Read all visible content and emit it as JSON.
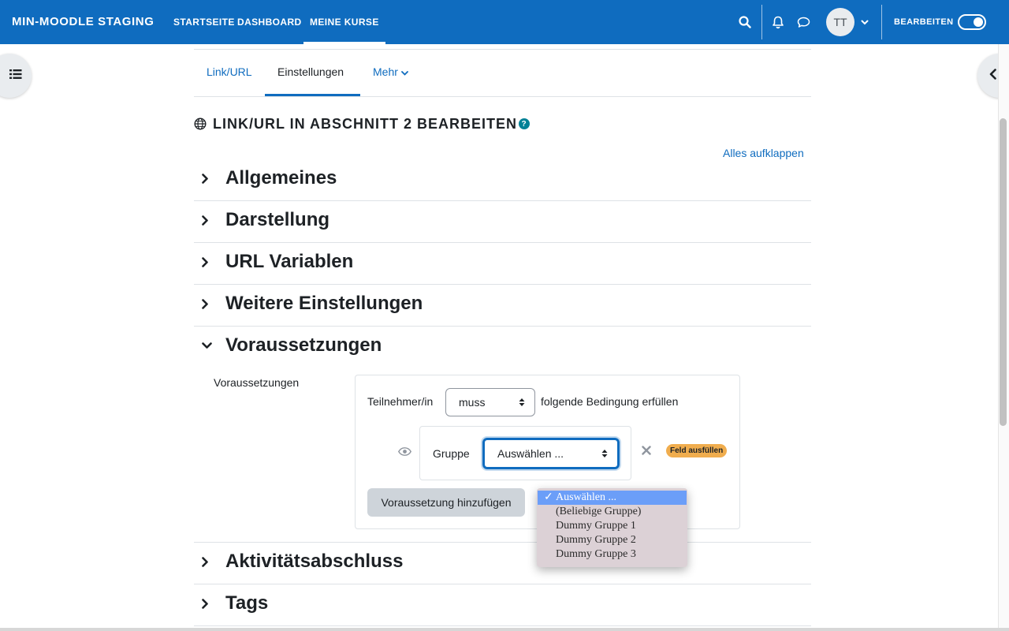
{
  "navbar": {
    "brand": "MIN-MOODLE STAGING",
    "links": [
      "STARTSEITE",
      "DASHBOARD",
      "MEINE KURSE"
    ],
    "active_link": "MEINE KURSE",
    "avatar_initials": "TT",
    "edit_label": "BEARBEITEN",
    "edit_mode_on": true,
    "brand_color": "#0f6cbf"
  },
  "tabs": {
    "items": [
      "Link/URL",
      "Einstellungen",
      "Mehr"
    ],
    "active": "Einstellungen"
  },
  "page": {
    "title": "LINK/URL IN ABSCHNITT 2 BEARBEITEN",
    "expand_all": "Alles aufklappen"
  },
  "sections": {
    "allgemeines": "Allgemeines",
    "darstellung": "Darstellung",
    "url_variablen": "URL Variablen",
    "weitere": "Weitere Einstellungen",
    "voraussetzungen": "Voraussetzungen",
    "aktivitaet": "Aktivitätsabschluss",
    "tags": "Tags"
  },
  "availability": {
    "label": "Voraussetzungen",
    "prefix": "Teilnehmer/in",
    "must_value": "muss",
    "suffix": "folgende Bedingung erfüllen",
    "condition_type": "Gruppe",
    "group_select_value": "Auswählen ...",
    "badge": "Feld ausfüllen",
    "add_button": "Voraussetzung hinzufügen"
  },
  "dropdown": {
    "options": [
      "Auswählen ...",
      "(Beliebige Gruppe)",
      "Dummy Gruppe 1",
      "Dummy Gruppe 2",
      "Dummy Gruppe 3"
    ],
    "selected": "Auswählen ..."
  }
}
